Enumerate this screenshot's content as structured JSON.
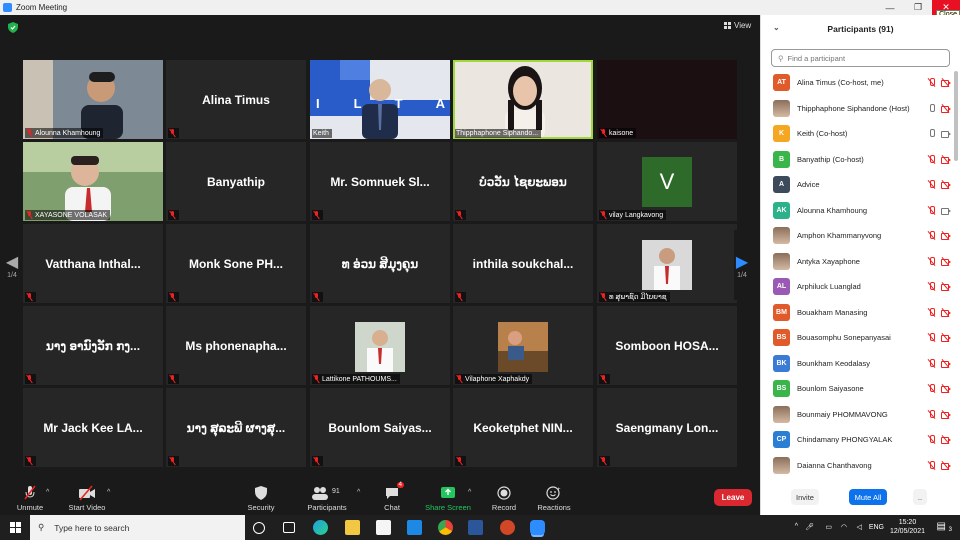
{
  "window": {
    "title": "Zoom Meeting",
    "close_tooltip": "Close"
  },
  "stage": {
    "view_label": "View",
    "page_left": "1/4",
    "page_right": "1/4"
  },
  "tiles": {
    "t1": {
      "label": "Alounna Khamhoung"
    },
    "t2": {
      "name": "Alina Timus"
    },
    "t3": {
      "label": "Keith",
      "logo_letters": "ILTA"
    },
    "t4": {
      "label": "Thipphaphone Siphando..."
    },
    "t5": {
      "label": "kaisone"
    },
    "t6": {
      "label": "XAYASONE VOLASAK"
    },
    "t7": {
      "name": "Banyathip"
    },
    "t8": {
      "name": "Mr. Somnuek Sl..."
    },
    "t9": {
      "name": "ບໍວວັນ ໄຊຍະພອນ"
    },
    "t10": {
      "label": "vilay Langkavong",
      "avatar": "V"
    },
    "t11": {
      "name": "Vatthana Inthal..."
    },
    "t12": {
      "name": "Monk Sone PH..."
    },
    "t13": {
      "name": "ທ ອ່ວນ ສີມຸງຄຸນ"
    },
    "t14": {
      "name": "inthila soukchal..."
    },
    "t15": {
      "label": "ທ ສຸພາຊົດ ມີໄບຍາຊ"
    },
    "t16": {
      "name": "ນາງ ອານົງວັກ ກງ..."
    },
    "t17": {
      "name": "Ms phonenapha..."
    },
    "t18": {
      "label": "Lattikone PATHOUMS..."
    },
    "t19": {
      "label": "Vilaphone Xaphakdy"
    },
    "t20": {
      "name": "Somboon HOSA..."
    },
    "t21": {
      "name": "Mr Jack Kee LA..."
    },
    "t22": {
      "name": "ນາງ ສຸລະພີ ຜາງສຸ..."
    },
    "t23": {
      "name": "Bounlom Saiyas..."
    },
    "t24": {
      "name": "Keoketphet NIN..."
    },
    "t25": {
      "name": "Saengmany Lon..."
    }
  },
  "toolbar": {
    "unmute": "Unmute",
    "start_video": "Start Video",
    "security": "Security",
    "participants": "Participants",
    "participants_count": "91",
    "chat": "Chat",
    "chat_badge": "4",
    "share_screen": "Share Screen",
    "record": "Record",
    "reactions": "Reactions",
    "leave": "Leave"
  },
  "panel": {
    "title": "Participants (91)",
    "search_placeholder": "Find a participant",
    "invite": "Invite",
    "mute_all": "Mute All",
    "more": "..",
    "participants": [
      {
        "initials": "AT",
        "color": "#e05a2a",
        "name": "Alina Timus (Co-host, me)"
      },
      {
        "initials": "",
        "color": "#4a7fc1",
        "name": "Thipphaphone Siphandone (Host)"
      },
      {
        "initials": "K",
        "color": "#f5a623",
        "name": "Keith (Co-host)"
      },
      {
        "initials": "B",
        "color": "#3ab54a",
        "name": "Banyathip (Co-host)"
      },
      {
        "initials": "A",
        "color": "#3d4a5c",
        "name": "Advice"
      },
      {
        "initials": "AK",
        "color": "#2bb28a",
        "name": "Alounna Khamhoung"
      },
      {
        "initials": "",
        "color": "#556",
        "name": "Amphon Khammanyvong"
      },
      {
        "initials": "",
        "color": "#b88",
        "name": "Antyka Xayaphone"
      },
      {
        "initials": "AL",
        "color": "#9b59b6",
        "name": "Arphiluck Luanglad"
      },
      {
        "initials": "BM",
        "color": "#e05a2a",
        "name": "Bouakham Manasing"
      },
      {
        "initials": "BS",
        "color": "#e05a2a",
        "name": "Bouasomphu Sonepanyasai"
      },
      {
        "initials": "BK",
        "color": "#3a7bd5",
        "name": "Bounkham Keodalasy"
      },
      {
        "initials": "BS",
        "color": "#3ab54a",
        "name": "Bounlom Saiyasone"
      },
      {
        "initials": "",
        "color": "#8aa",
        "name": "Bounmaiy PHOMMAVONG"
      },
      {
        "initials": "CP",
        "color": "#2a7fd5",
        "name": "Chindamany PHONGYALAK"
      },
      {
        "initials": "",
        "color": "#b99",
        "name": "Daianna Chanthavong"
      }
    ]
  },
  "taskbar": {
    "search_placeholder": "Type here to search",
    "lang": "ENG",
    "time": "15:20",
    "date": "12/05/2021",
    "notif_count": "3"
  }
}
